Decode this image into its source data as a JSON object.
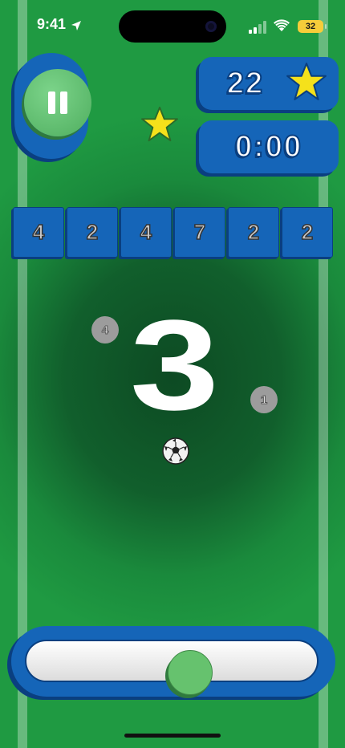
{
  "status_bar": {
    "time": "9:41",
    "battery": "32"
  },
  "hud": {
    "score": "22",
    "timer": "0:00"
  },
  "tiles": [
    "4",
    "2",
    "4",
    "7",
    "2",
    "2"
  ],
  "target_number": "3",
  "bubbles": [
    "4",
    "1"
  ],
  "colors": {
    "panel": "#1565b8",
    "panel_shadow": "#0a3f80",
    "field": "#1a8a3c",
    "accent_green": "#66c26e",
    "star": "#f5e11b"
  },
  "icons": [
    "location-arrow-icon",
    "signal-icon",
    "wifi-icon",
    "battery-icon",
    "pause-icon",
    "star-icon",
    "soccer-ball-icon"
  ]
}
